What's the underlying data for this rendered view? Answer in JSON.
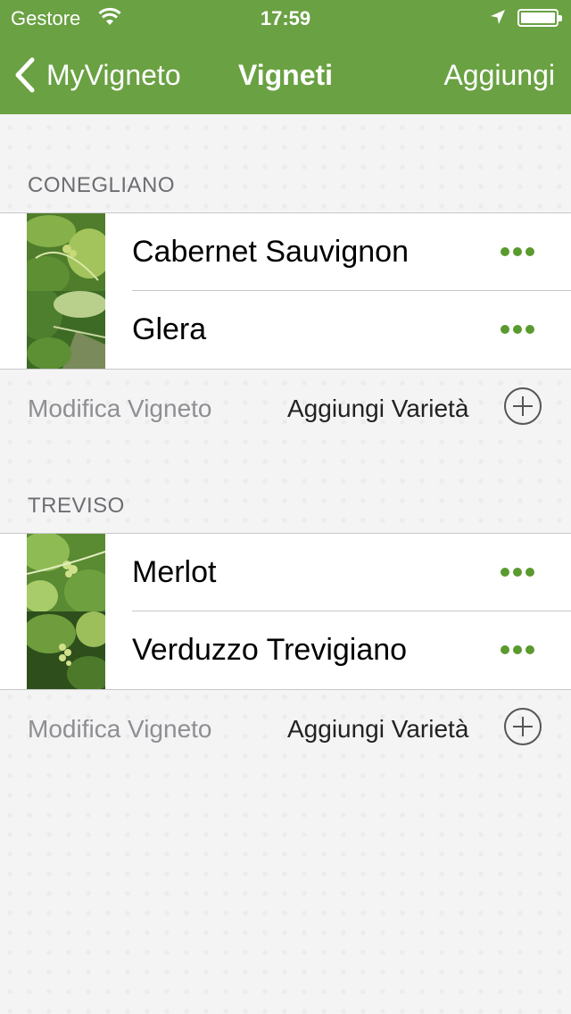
{
  "status_bar": {
    "carrier": "Gestore",
    "time": "17:59"
  },
  "nav": {
    "back_label": "MyVigneto",
    "title": "Vigneti",
    "add_label": "Aggiungi"
  },
  "colors": {
    "accent": "#6aa143",
    "dots": "#5a9a2e"
  },
  "vineyards": [
    {
      "name": "CONEGLIANO",
      "varieties": [
        {
          "name": "Cabernet Sauvignon",
          "icon": "more-dots-icon"
        },
        {
          "name": "Glera",
          "icon": "more-dots-icon"
        }
      ],
      "edit_label": "Modifica Vigneto",
      "add_variety_label": "Aggiungi Varietà"
    },
    {
      "name": "TREVISO",
      "varieties": [
        {
          "name": "Merlot",
          "icon": "more-dots-icon"
        },
        {
          "name": "Verduzzo Trevigiano",
          "icon": "more-dots-icon"
        }
      ],
      "edit_label": "Modifica Vigneto",
      "add_variety_label": "Aggiungi Varietà"
    }
  ]
}
